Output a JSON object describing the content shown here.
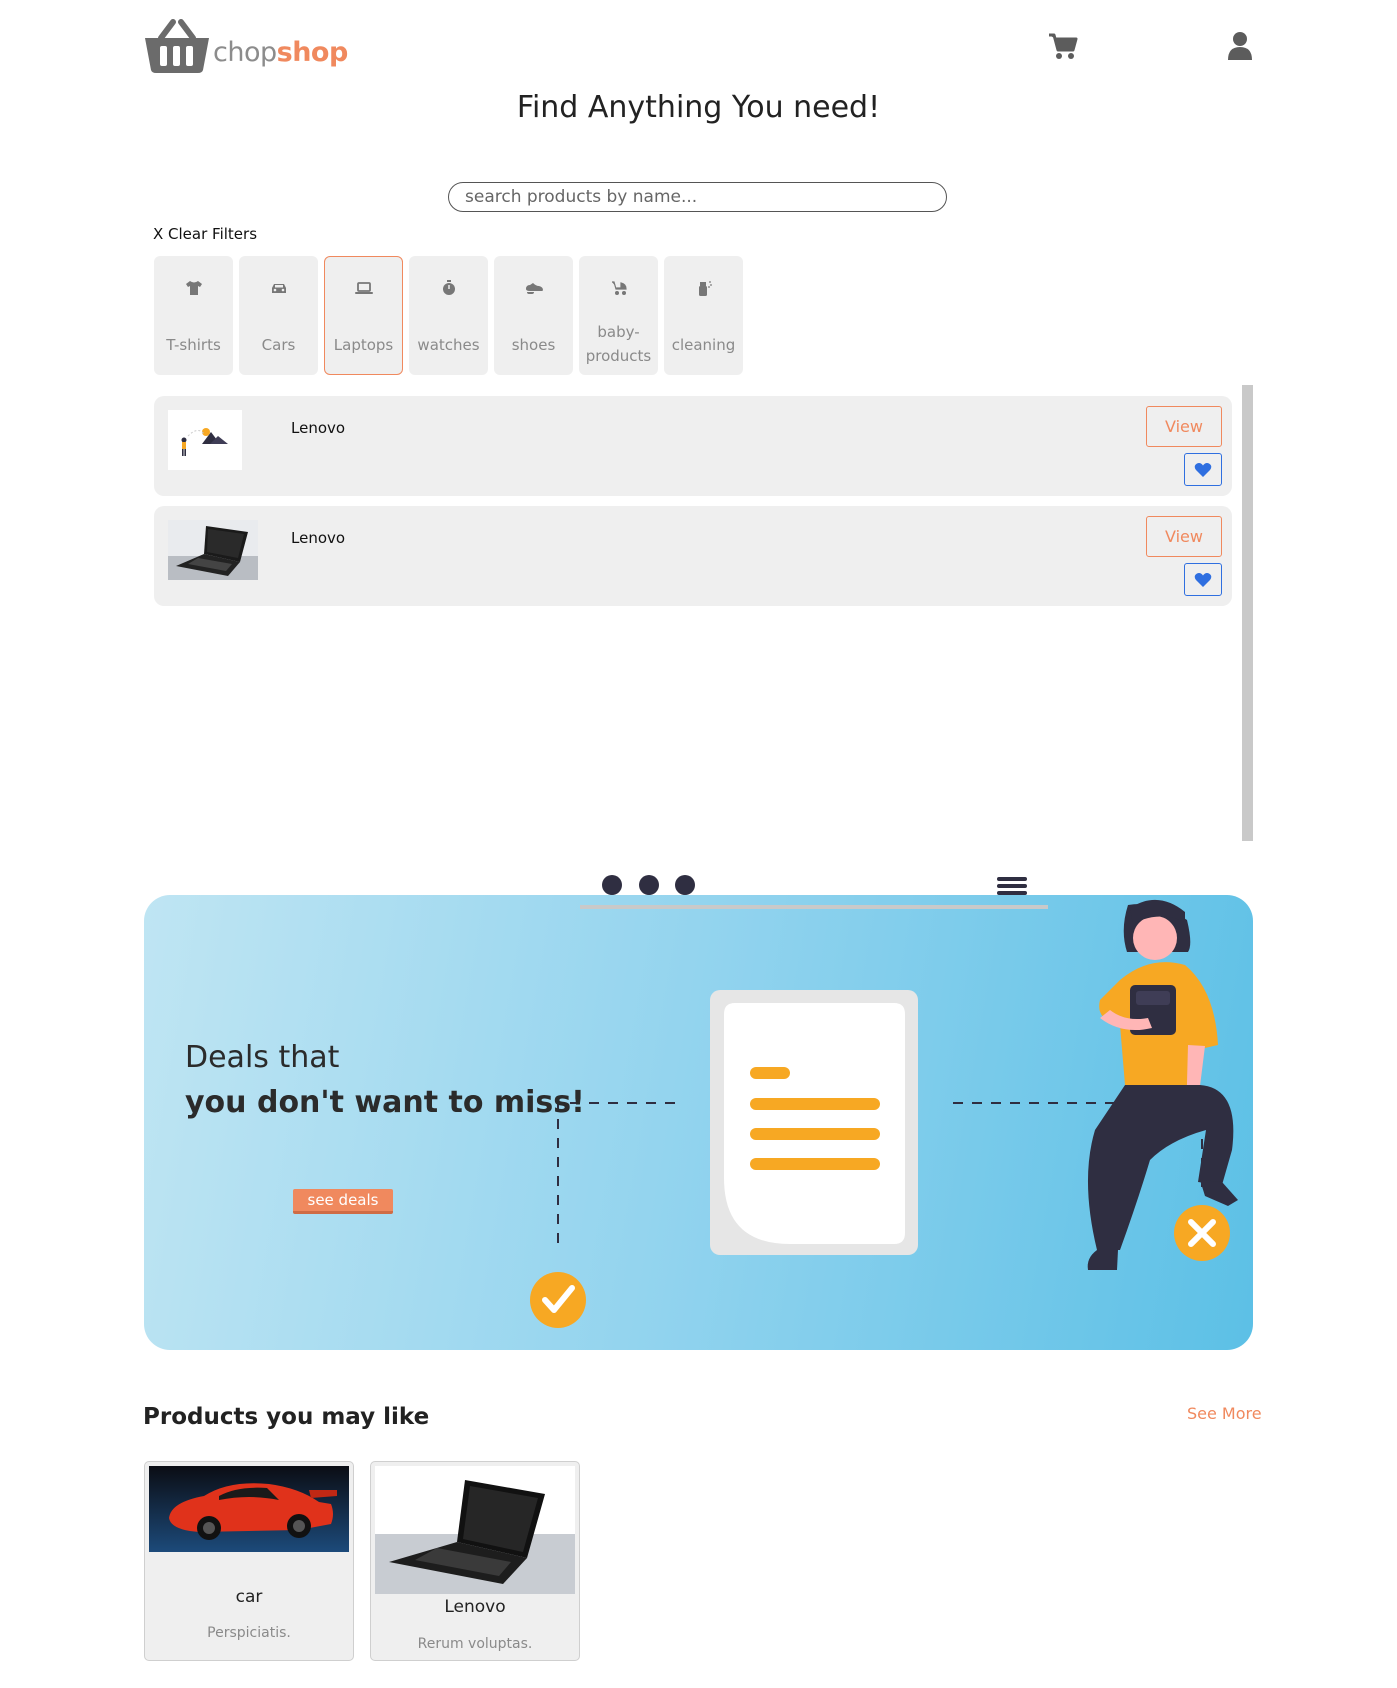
{
  "header": {
    "logo_word1": "chop",
    "logo_word2": "shop",
    "cart_icon": "shopping-cart-icon",
    "user_icon": "user-icon"
  },
  "headline": "Find Anything You need!",
  "search": {
    "placeholder": "search products by name...",
    "value": ""
  },
  "clear_filters": "X Clear Filters",
  "categories": [
    {
      "label": "T-shirts",
      "icon": "tshirt-icon",
      "active": false
    },
    {
      "label": "Cars",
      "icon": "car-icon",
      "active": false
    },
    {
      "label": "Laptops",
      "icon": "laptop-icon",
      "active": true
    },
    {
      "label": "watches",
      "icon": "stopwatch-icon",
      "active": false
    },
    {
      "label": "shoes",
      "icon": "shoe-icon",
      "active": false
    },
    {
      "label": "baby-products",
      "icon": "baby-carriage-icon",
      "active": false
    },
    {
      "label": "cleaning",
      "icon": "spray-bottle-icon",
      "active": false
    }
  ],
  "results": [
    {
      "name": "Lenovo",
      "view_label": "View",
      "favorite_icon": "heart-icon"
    },
    {
      "name": "Lenovo",
      "view_label": "View",
      "favorite_icon": "heart-icon"
    }
  ],
  "banner": {
    "line1": "Deals that",
    "line2": "you don't want to miss!",
    "button": "see deals"
  },
  "recommended": {
    "title": "Products you may like",
    "see_more": "See More",
    "items": [
      {
        "name": "car",
        "description": "Perspiciatis."
      },
      {
        "name": "Lenovo",
        "description": "Rerum voluptas."
      }
    ]
  },
  "colors": {
    "accent": "#f0895e",
    "panel": "#efefef",
    "favorite": "#2f6fe0",
    "illustration_yellow": "#f7a823",
    "illustration_dark": "#2f2e41"
  }
}
